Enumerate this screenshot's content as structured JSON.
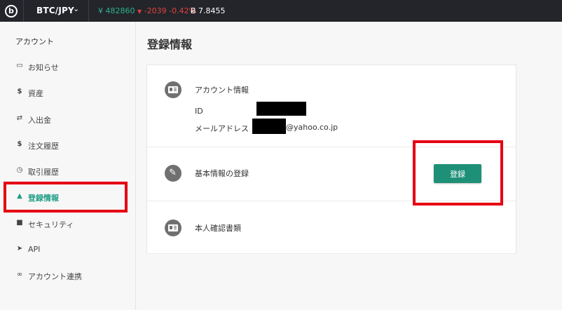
{
  "topbar": {
    "pair": "BTC/JPY",
    "price": "¥ 482860",
    "change": "-2039 -0.42%",
    "btc_stat": "Ƀ 7.8455",
    "colors": {
      "up": "#2fb18a",
      "down": "#e0433b"
    }
  },
  "sidebar": {
    "title": "アカウント",
    "items": [
      {
        "label": "お知らせ",
        "icon": "inbox-icon"
      },
      {
        "label": "資産",
        "icon": "dollar-icon"
      },
      {
        "label": "入出金",
        "icon": "transfer-icon"
      },
      {
        "label": "注文履歴",
        "icon": "dollar-icon"
      },
      {
        "label": "取引履歴",
        "icon": "clock-icon"
      },
      {
        "label": "登録情報",
        "icon": "user-icon",
        "active": true
      },
      {
        "label": "セキュリティ",
        "icon": "lock-icon"
      },
      {
        "label": "API",
        "icon": "send-icon"
      },
      {
        "label": "アカウント連携",
        "icon": "link-icon"
      }
    ]
  },
  "main": {
    "title": "登録情報",
    "account": {
      "title": "アカウント情報",
      "id_label": "ID",
      "email_label": "メールアドレス",
      "email_domain": "@yahoo.co.jp"
    },
    "basic": {
      "title": "基本情報の登録",
      "button": "登録"
    },
    "identity": {
      "title": "本人確認書類"
    }
  },
  "accent_color": "#1f9078",
  "highlight_color": "#e50012"
}
